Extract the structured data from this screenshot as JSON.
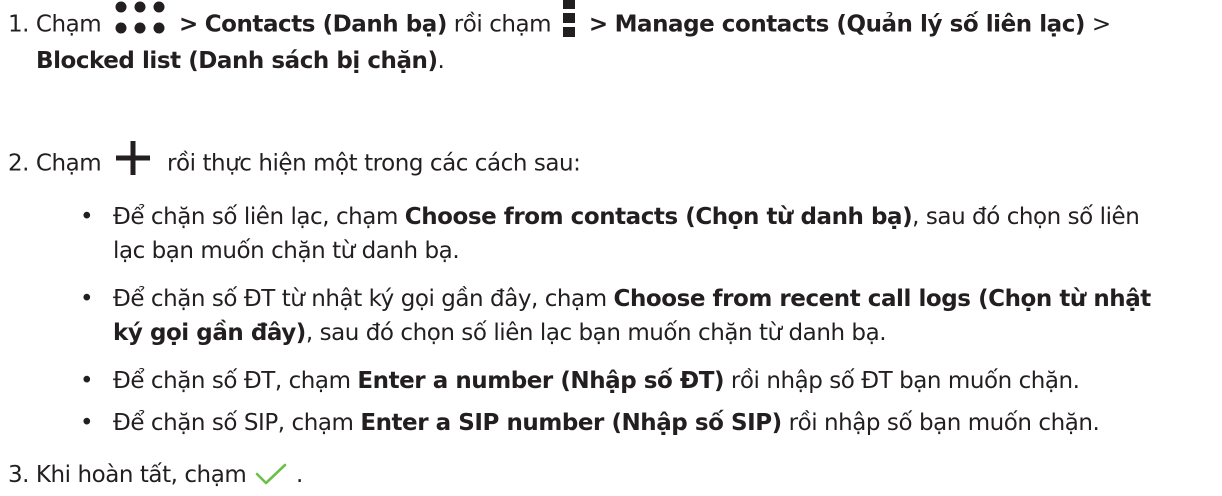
{
  "step1": {
    "number": "1.",
    "before_icon1": "Chạm",
    "icon1": "three-dots-icon",
    "sep1": ">",
    "contacts": "Contacts (Danh bạ)",
    "mid": "rồi chạm",
    "icon2": "menu-icon",
    "sep2": ">",
    "manage": "Manage contacts (Quản lý số liên lạc)",
    "sep3": ">",
    "blocked": "Blocked list (Danh sách bị chặn)",
    "end": "."
  },
  "step2": {
    "number": "2.",
    "before_icon": "Chạm",
    "icon": "plus-icon",
    "after_icon": "rồi thực hiện một trong các cách sau:",
    "bullets": [
      {
        "pre": "Để chặn số liên lạc, chạm",
        "bold": "Choose from contacts (Chọn từ danh bạ)",
        "post_line1": ", sau đó chọn số liên",
        "line2": "lạc bạn muốn chặn từ danh bạ."
      },
      {
        "pre": "Để chặn số ĐT từ nhật ký gọi gần đây, chạm",
        "bold_line1": "Choose from recent call logs (Chọn từ nhật",
        "bold_line2": "ký gọi gần đây)",
        "post": ", sau đó chọn số liên lạc bạn muốn chặn từ danh bạ."
      },
      {
        "pre": "Để chặn số ĐT, chạm",
        "bold": "Enter a number (Nhập số ĐT)",
        "post": "rồi nhập số ĐT bạn muốn chặn."
      },
      {
        "pre": "Để chặn số SIP, chạm",
        "bold": "Enter a SIP number (Nhập số SIP)",
        "post": "rồi nhập số bạn muốn chặn."
      }
    ]
  },
  "step3": {
    "number": "3.",
    "text": "Khi hoàn tất, chạm",
    "icon": "checkmark-icon",
    "end": "."
  },
  "colors": {
    "text": "#231f20",
    "checkmark": "#6cc04a"
  }
}
